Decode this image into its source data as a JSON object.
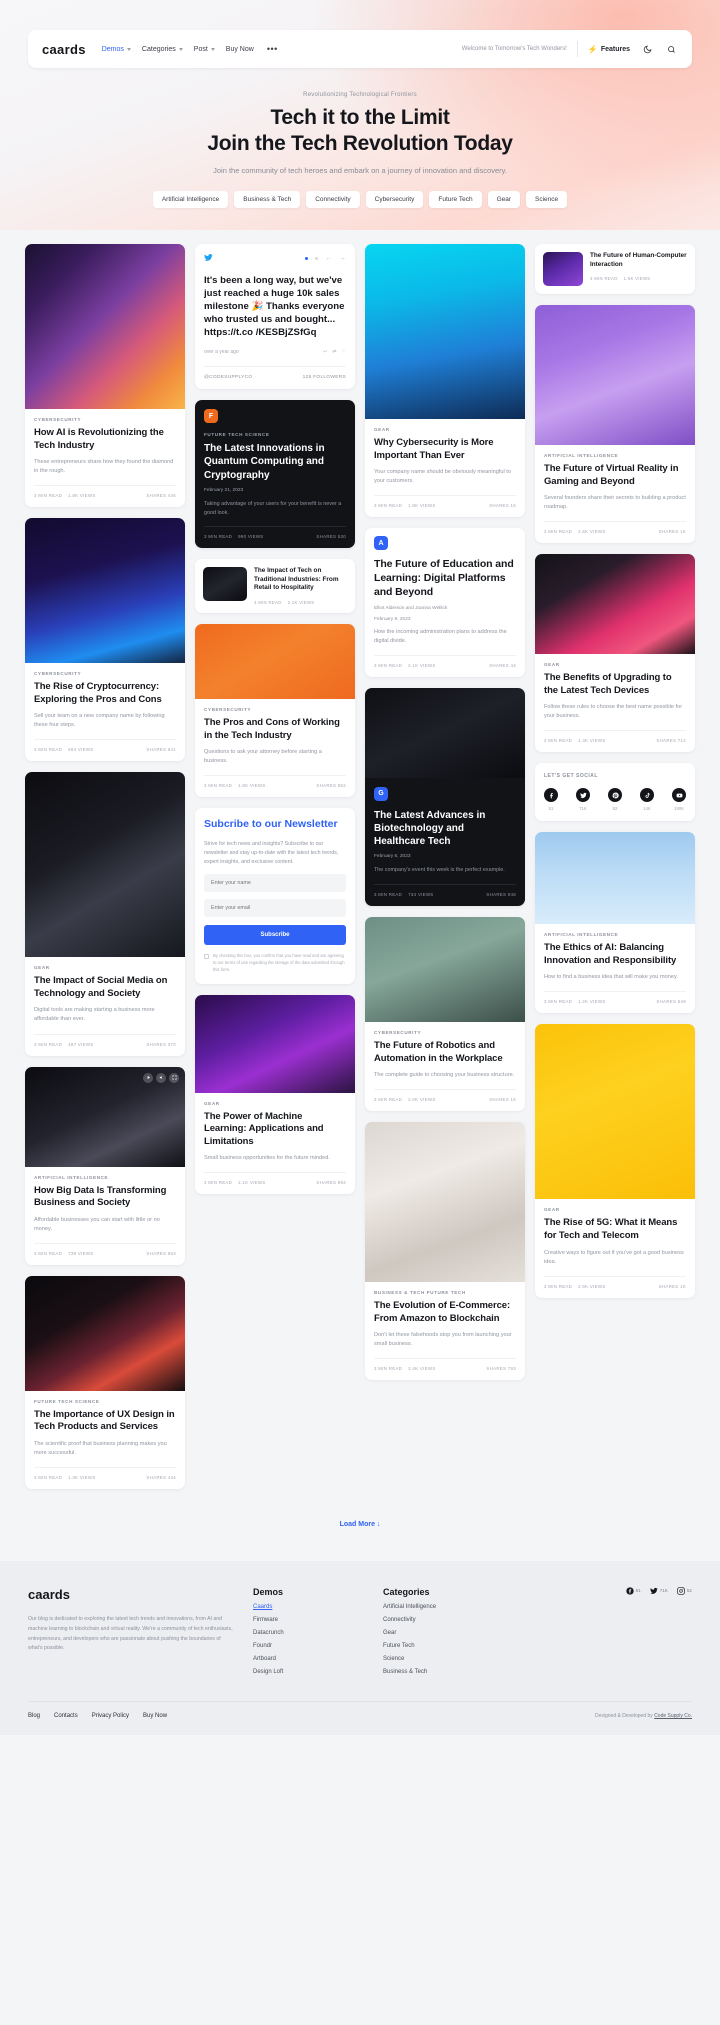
{
  "nav": {
    "logo": "caards",
    "links": [
      {
        "label": "Demos",
        "caret": true,
        "active": true
      },
      {
        "label": "Categories",
        "caret": true,
        "active": false
      },
      {
        "label": "Post",
        "caret": true,
        "active": false
      },
      {
        "label": "Buy Now",
        "caret": false,
        "active": false
      }
    ],
    "more": "•••",
    "note": "Welcome to Tomorrow's Tech Wonders!",
    "features": "Features",
    "theme_icon": "moon-icon",
    "search_icon": "search-icon"
  },
  "hero": {
    "eyebrow": "Revolutionizing Technological Frontiers",
    "title_line1": "Tech it to the Limit",
    "title_line2": "Join the Tech Revolution Today",
    "subtitle": "Join the community of tech heroes and embark on a journey of innovation and discovery.",
    "pills": [
      "Artificial Intelligence",
      "Business & Tech",
      "Connectivity",
      "Cybersecurity",
      "Future Tech",
      "Gear",
      "Science"
    ]
  },
  "cards": {
    "ai_revolution": {
      "kicker": "CYBERSECURITY",
      "title": "How AI is Revolutionizing the Tech Industry",
      "excerpt": "These entrepreneurs share how they found the diamond in the rough.",
      "read": "3 MIN READ",
      "views": "1.8K VIEWS",
      "shares": "SHARES 446"
    },
    "crypto": {
      "kicker": "CYBERSECURITY",
      "title": "The Rise of Cryptocurrency: Exploring the Pros and Cons",
      "excerpt": "Sell your team on a new company name by following these four steps.",
      "read": "3 MIN READ",
      "views": "694 VIEWS",
      "shares": "SHARES 841"
    },
    "social_media": {
      "kicker": "GEAR",
      "title": "The Impact of Social Media on Technology and Society",
      "excerpt": "Digital tools are making starting a business more affordable than ever.",
      "read": "3 MIN READ",
      "views": "487 VIEWS",
      "shares": "SHARES 370"
    },
    "big_data": {
      "kicker": "ARTIFICIAL INTELLIGENCE",
      "title": "How Big Data Is Transforming Business and Society",
      "excerpt": "Affordable businesses you can start with little or no money.",
      "read": "3 MIN READ",
      "views": "739 VIEWS",
      "shares": "SHARES 953"
    },
    "ux_design": {
      "kicker": "FUTURE TECH SCIENCE",
      "title": "The Importance of UX Design in Tech Products and Services",
      "excerpt": "The scientific proof that business planning makes you more successful.",
      "read": "3 MIN READ",
      "views": "1.3K VIEWS",
      "shares": "SHARES 444"
    },
    "tweet": {
      "text": "It's been a long way, but we've just reached a huge 10k sales milestone 🎉 Thanks everyone who trusted us and bought... https://t.co /KESBjZSfGq",
      "time": "over a year ago",
      "handle": "@CODESUPPLYCO",
      "followers": "125 FOLLOWERS"
    },
    "quantum": {
      "badge": "F",
      "kicker": "FUTURE TECH SCIENCE",
      "title": "The Latest Innovations in Quantum Computing and Cryptography",
      "date": "February 21, 2023",
      "excerpt": "Taking advantage of your users for your benefit is never a good look.",
      "read": "3 MIN READ",
      "views": "990 VIEWS",
      "shares": "SHARES 530"
    },
    "retail": {
      "title": "The Impact of Tech on Traditional Industries: From Retail to Hospitality",
      "read": "3 MIN READ",
      "views": "2.1K VIEWS"
    },
    "pros_cons": {
      "kicker": "CYBERSECURITY",
      "title": "The Pros and Cons of Working in the Tech Industry",
      "excerpt": "Questions to ask your attorney before starting a business.",
      "read": "3 MIN READ",
      "views": "1.8K VIEWS",
      "shares": "SHARES 952"
    },
    "newsletter": {
      "title": "Subcribe to our Newsletter",
      "body": "Strive for tech news and insights? Subscribe to our newsletter and stay up-to-date with the latest tech trends, expert insights, and exclusive content.",
      "name_placeholder": "Enter your name",
      "email_placeholder": "Enter your email",
      "button": "Subscribe",
      "consent": "By checking this box, you confirm that you have read and are agreeing to our terms of use regarding the storage of the data submitted through this form."
    },
    "why_cyber": {
      "kicker": "GEAR",
      "title": "Why Cybersecurity is More Important Than Ever",
      "excerpt": "Your company name should be obviously meaningful to your customers.",
      "read": "3 MIN READ",
      "views": "1.8K VIEWS",
      "shares": "SHARES 16"
    },
    "education": {
      "badge": "A",
      "title": "The Future of Education and Learning: Digital Platforms and Beyond",
      "author1": "Elliot Alderson",
      "and": "and",
      "author2": "Joanna Wellick",
      "date": "February 8, 2023",
      "excerpt": "How the incoming administration plans to address the digital divide.",
      "read": "3 MIN READ",
      "views": "2.1K VIEWS",
      "shares": "SHARES 44"
    },
    "biotech": {
      "badge": "G",
      "title": "The Latest Advances in Biotechnology and Healthcare Tech",
      "date": "February 6, 2023",
      "excerpt": "The company's event this week is the perfect example.",
      "read": "3 MIN READ",
      "views": "734 VIEWS",
      "shares": "SHARES 948"
    },
    "robotics": {
      "kicker": "CYBERSECURITY",
      "title": "The Future of Robotics and Automation in the Workplace",
      "excerpt": "The complete guide to choosing your business structure.",
      "read": "3 MIN READ",
      "views": "2.0K VIEWS",
      "shares": "SHARES 16"
    },
    "ecommerce": {
      "kicker": "BUSINESS & TECH FUTURE TECH",
      "title": "The Evolution of E-Commerce: From Amazon to Blockchain",
      "excerpt": "Don't let these falsehoods stop you from launching your small business.",
      "read": "3 MIN READ",
      "views": "2.4K VIEWS",
      "shares": "SHARES 793"
    },
    "hci": {
      "title": "The Future of Human-Computer Interaction",
      "read": "3 MIN READ",
      "views": "1.6K VIEWS"
    },
    "vr_gaming": {
      "kicker": "ARTIFICIAL INTELLIGENCE",
      "title": "The Future of Virtual Reality in Gaming and Beyond",
      "excerpt": "Several founders share their secrets to building a product roadmap.",
      "read": "3 MIN READ",
      "views": "2.6K VIEWS",
      "shares": "SHARES 1K"
    },
    "upgrading": {
      "kicker": "GEAR",
      "title": "The Benefits of Upgrading to the Latest Tech Devices",
      "excerpt": "Follow these rules to choose the best name possible for your business.",
      "read": "3 MIN READ",
      "views": "1.3K VIEWS",
      "shares": "SHARES 712"
    },
    "social_box": {
      "label": "LET'S GET SOCIAL",
      "items": [
        {
          "icon": "facebook-icon",
          "count": "51"
        },
        {
          "icon": "twitter-icon",
          "count": "71K"
        },
        {
          "icon": "pinterest-icon",
          "count": "52"
        },
        {
          "icon": "tiktok-icon",
          "count": "14K"
        },
        {
          "icon": "youtube-icon",
          "count": "190K"
        }
      ]
    },
    "ethics_ai": {
      "kicker": "ARTIFICIAL INTELLIGENCE",
      "title": "The Ethics of AI: Balancing Innovation and Responsibility",
      "excerpt": "How to find a business idea that will make you money.",
      "read": "3 MIN READ",
      "views": "1.2K VIEWS",
      "shares": "SHARES 549"
    },
    "rise_5g": {
      "kicker": "GEAR",
      "title": "The Rise of 5G: What it Means for Tech and Telecom",
      "excerpt": "Creative ways to figure out if you've got a good business idea.",
      "read": "3 MIN READ",
      "views": "2.9K VIEWS",
      "shares": "SHARES 1K"
    },
    "machine_learning": {
      "kicker": "GEAR",
      "title": "The Power of Machine Learning: Applications and Limitations",
      "excerpt": "Small business opportunities for the future minded.",
      "read": "3 MIN READ",
      "views": "2.1K VIEWS",
      "shares": "SHARES 984"
    }
  },
  "load_more": "Load More",
  "footer": {
    "logo": "caards",
    "about": "Our blog is dedicated to exploring the latest tech trends and innovations, from AI and machine learning to blockchain and virtual reality. We're a community of tech enthusiasts, entrepreneurs, and developers who are passionate about pushing the boundaries of what's possible.",
    "demos_title": "Demos",
    "demos": [
      "Caards",
      "Firmware",
      "Datacrunch",
      "Foundr",
      "Artboard",
      "Design Loft"
    ],
    "categories_title": "Categories",
    "categories": [
      "Artificial Intelligence",
      "Connectivity",
      "Gear",
      "Future Tech",
      "Science",
      "Business & Tech"
    ],
    "social": [
      {
        "icon": "facebook-icon",
        "count": "51"
      },
      {
        "icon": "twitter-icon",
        "count": "71K"
      },
      {
        "icon": "instagram-icon",
        "count": "52"
      }
    ],
    "bottom_links": [
      "Blog",
      "Contacts",
      "Privacy Policy",
      "Buy Now"
    ],
    "credit_prefix": "Designed & Developed by ",
    "credit_link": "Code Supply Co."
  }
}
